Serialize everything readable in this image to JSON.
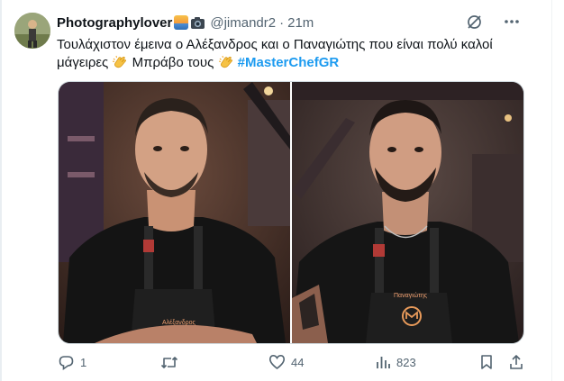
{
  "tweet": {
    "author": {
      "display_name": "Photographylover",
      "handle": "@jimandr2",
      "time": "21m",
      "avatar_icon": "avatar-photo"
    },
    "text_line1": "Τουλάχιστον έμεινα ο Αλέξανδρος και ο Παναγιώτης που είναι πολύ καλοί",
    "text_line2_a": "μάγειρες",
    "text_line2_b": "Μπράβο τους",
    "hashtag": "#MasterChefGR",
    "media": [
      {
        "apron_name": "Αλέξανδρος"
      },
      {
        "apron_name": "Παναγιώτης"
      }
    ]
  },
  "actions": {
    "replies": "1",
    "retweets": "",
    "likes": "44",
    "views": "823"
  },
  "colors": {
    "accent": "#1d9bf0",
    "muted": "#536471",
    "text": "#0f1419"
  }
}
